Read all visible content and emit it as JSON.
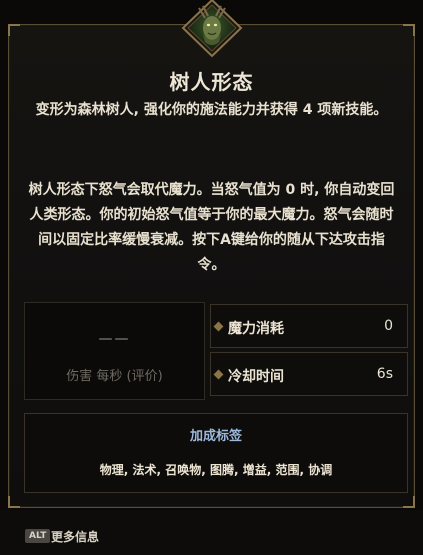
{
  "ability": {
    "title": "树人形态",
    "subtitle": "变形为森林树人, 强化你的施法能力并获得 4 项新技能。",
    "description": "树人形态下怒气会取代魔力。当怒气值为 0 时, 你自动变回人类形态。你的初始怒气值等于你的最大魔力。怒气会随时间以固定比率缓慢衰减。按下A键给你的随从下达攻击指令。",
    "portrait_icon": "treant-head-icon"
  },
  "stats": {
    "dps_value": "——",
    "dps_label": "伤害 每秒 (评价)",
    "mana_cost_label": "魔力消耗",
    "mana_cost_value": "0",
    "cooldown_label": "冷却时间",
    "cooldown_value": "6s"
  },
  "tags": {
    "title": "加成标签",
    "list": "物理, 法术, 召唤物, 图腾, 增益, 范围, 协调"
  },
  "footer": {
    "alt_key": "ALT",
    "more_info": "更多信息"
  },
  "colors": {
    "frame_gold": "#8a7449",
    "tag_title_blue": "#9db9dc",
    "text_light": "#ece4d2"
  }
}
